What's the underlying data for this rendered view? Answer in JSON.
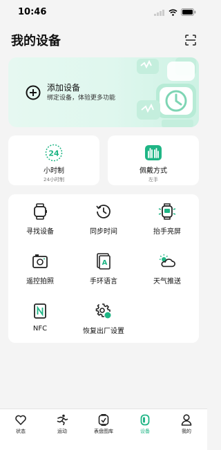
{
  "status_bar": {
    "time": "10:46"
  },
  "header": {
    "title": "我的设备"
  },
  "add_device": {
    "title": "添加设备",
    "subtitle": "绑定设备，体验更多功能"
  },
  "cards": {
    "time_format": {
      "icon_text": "24",
      "label": "小时制",
      "sub": "24小时制"
    },
    "wear": {
      "label": "佩戴方式",
      "sub": "左手"
    }
  },
  "grid": [
    {
      "label": "寻找设备",
      "icon": "watch-icon"
    },
    {
      "label": "同步时间",
      "icon": "clock-sync-icon"
    },
    {
      "label": "抬手亮屏",
      "icon": "watch-glow-icon"
    },
    {
      "label": "遥控拍照",
      "icon": "camera-icon"
    },
    {
      "label": "手环语言",
      "icon": "language-icon"
    },
    {
      "label": "天气推送",
      "icon": "weather-icon"
    },
    {
      "label": "NFC",
      "icon": "nfc-icon"
    },
    {
      "label": "恢复出厂设置",
      "icon": "factory-reset-icon"
    }
  ],
  "tabs": [
    {
      "label": "状态",
      "icon": "heart-icon",
      "active": false
    },
    {
      "label": "运动",
      "icon": "sport-icon",
      "active": false
    },
    {
      "label": "表盘图库",
      "icon": "watchface-icon",
      "active": false
    },
    {
      "label": "设备",
      "icon": "device-icon",
      "active": true
    },
    {
      "label": "我的",
      "icon": "profile-icon",
      "active": false
    }
  ],
  "colors": {
    "accent": "#1fb585",
    "background": "#f4f4f4",
    "card": "#ffffff"
  }
}
